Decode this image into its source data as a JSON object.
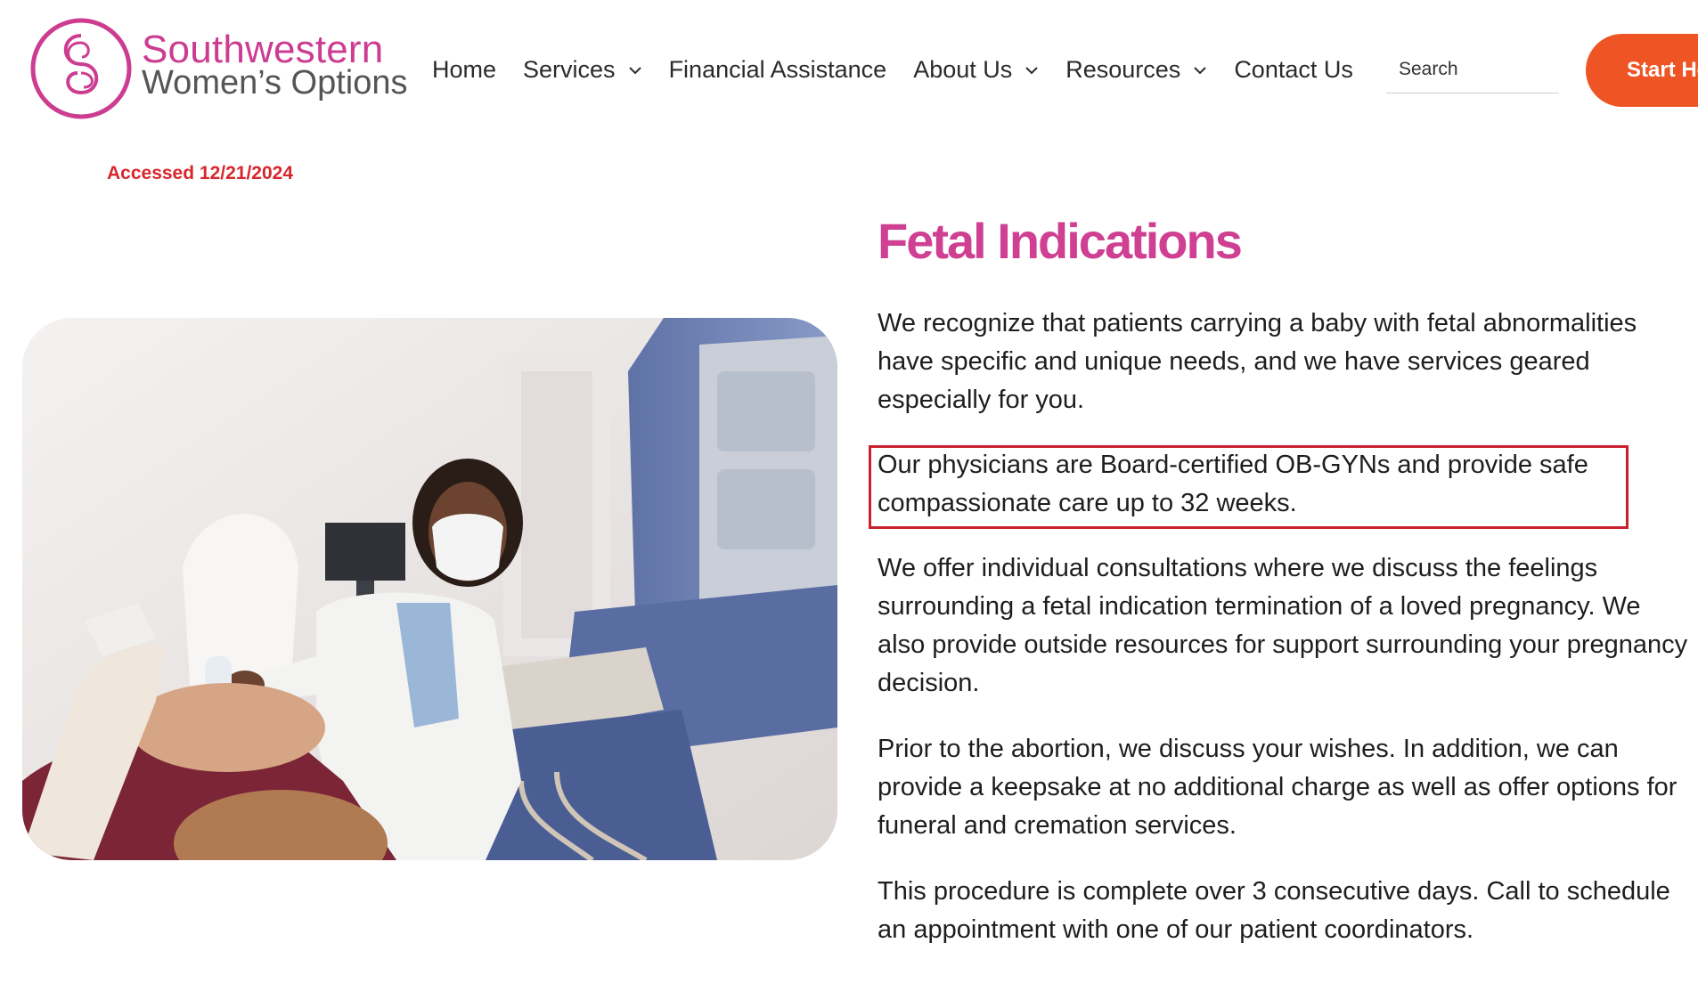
{
  "logo": {
    "line1": "Southwestern",
    "line2": "Women’s Options"
  },
  "nav": {
    "items": [
      {
        "label": "Home",
        "dropdown": false
      },
      {
        "label": "Services",
        "dropdown": true
      },
      {
        "label": "Financial Assistance",
        "dropdown": false
      },
      {
        "label": "About Us",
        "dropdown": true
      },
      {
        "label": "Resources",
        "dropdown": true
      },
      {
        "label": "Contact Us",
        "dropdown": false
      }
    ]
  },
  "search": {
    "placeholder": "Search"
  },
  "cta": {
    "label": "Start He"
  },
  "accessed": "Accessed 12/21/2024",
  "content": {
    "title": "Fetal Indications",
    "paragraphs": [
      "We recognize that patients carrying a baby with fetal abnormalities have specific and unique needs, and we have services geared especially for you.",
      "Our physicians are Board-certified OB-GYNs and provide safe compassionate care up to 32 weeks.",
      "We offer individual consultations where we discuss the feelings surrounding a fetal indication termination of a loved pregnancy. We also provide outside resources for support surrounding your pregnancy decision.",
      "Prior to the abortion, we discuss your wishes. In addition, we can provide a keepsake at no additional charge as well as offer options for funeral and cremation services.",
      "This procedure is complete over 3 consecutive days. Call to schedule an appointment with one of our patient coordinators."
    ]
  },
  "colors": {
    "brand_pink": "#cf3f92",
    "cta_orange": "#ee5424",
    "highlight_red": "#c8202e"
  }
}
